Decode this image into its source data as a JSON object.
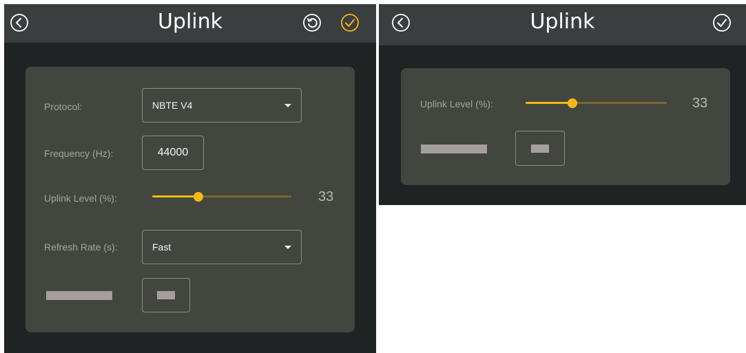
{
  "left_screen": {
    "header": {
      "title": "Uplink",
      "back_icon": "circle-chevron-left-icon",
      "reset_icon": "circle-reset-icon",
      "confirm_icon": "circle-check-icon",
      "confirm_color": "#f4b917"
    },
    "fields": {
      "protocol": {
        "label": "Protocol:",
        "value": "NBTE V4"
      },
      "frequency": {
        "label": "Frequency (Hz):",
        "value": "44000"
      },
      "uplink_level": {
        "label": "Uplink Level (%):",
        "value": "33",
        "level_percent": 33
      },
      "refresh_rate": {
        "label": "Refresh Rate (s):",
        "value": "Fast"
      }
    }
  },
  "right_screen": {
    "header": {
      "title": "Uplink",
      "back_icon": "circle-chevron-left-icon",
      "confirm_icon": "circle-check-icon",
      "confirm_color": "#ffffff"
    },
    "fields": {
      "uplink_level": {
        "label": "Uplink Level (%):",
        "value": "33",
        "level_percent": 33
      }
    }
  },
  "colors": {
    "accent": "#f4b917",
    "panel": "#43463f",
    "header": "#3b3e3f",
    "background": "#1f2324"
  }
}
